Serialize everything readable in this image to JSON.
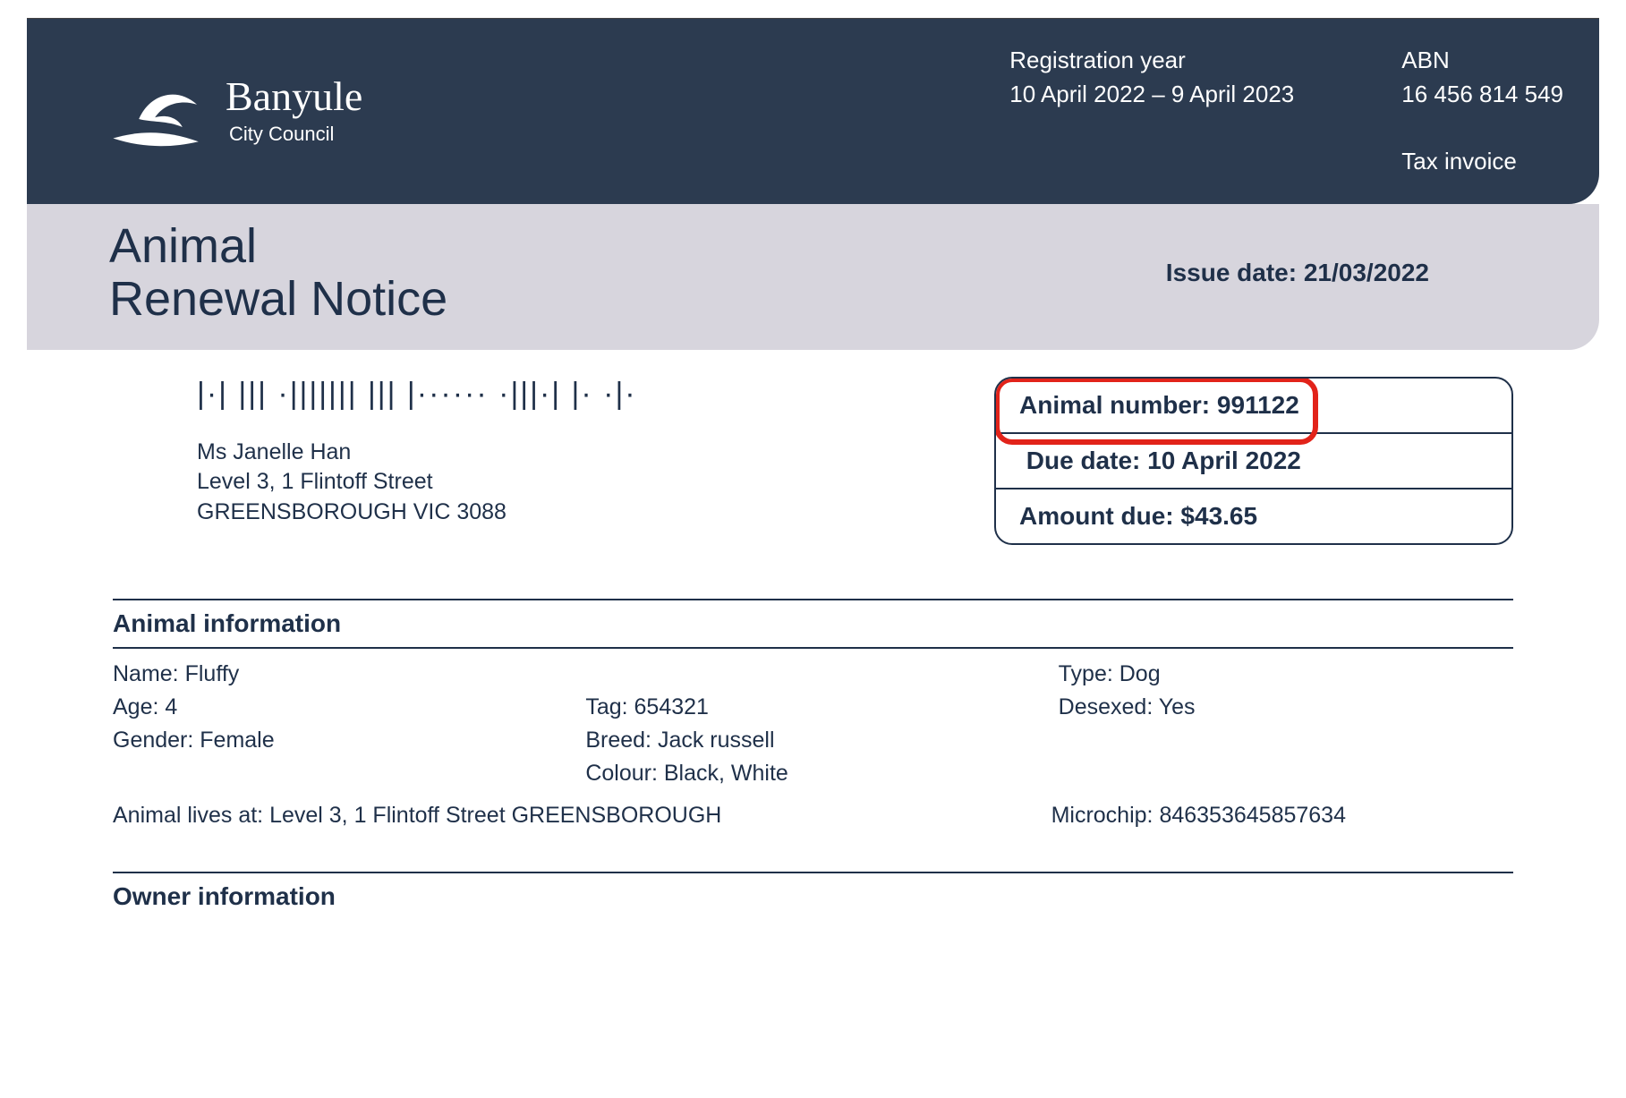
{
  "brand": {
    "name": "Banyule",
    "sub": "City Council"
  },
  "top": {
    "reg_label": "Registration year",
    "reg_value": "10 April 2022 – 9 April 2023",
    "abn_label": "ABN",
    "abn_value": "16 456 814 549",
    "tax_invoice": "Tax invoice"
  },
  "title_line1": "Animal",
  "title_line2": "Renewal Notice",
  "issue_date_label": "Issue date: ",
  "issue_date": "21/03/2022",
  "recipient": {
    "name": "Ms Janelle Han",
    "addr1": "Level 3, 1 Flintoff Street",
    "addr2": "GREENSBOROUGH  VIC  3088"
  },
  "keybox": {
    "animal_number_label": "Animal number: ",
    "animal_number": "991122",
    "due_date_label": "Due date: ",
    "due_date": "10 April 2022",
    "amount_due_label": "Amount due: ",
    "amount_due": "$43.65"
  },
  "sections": {
    "animal_info": "Animal information",
    "owner_info": "Owner information"
  },
  "animal": {
    "name_label": "Name: ",
    "name": "Fluffy",
    "age_label": "Age: ",
    "age": "4",
    "gender_label": "Gender: ",
    "gender": "Female",
    "tag_label": "Tag: ",
    "tag": "654321",
    "breed_label": "Breed: ",
    "breed": "Jack russell",
    "colour_label": "Colour: ",
    "colour": "Black, White",
    "type_label": "Type: ",
    "type": "Dog",
    "desexed_label": "Desexed: ",
    "desexed": "Yes",
    "lives_label": "Animal lives at: ",
    "lives_at": "Level 3, 1 Flintoff Street GREENSBOROUGH",
    "microchip_label": "Microchip: ",
    "microchip": "846353645857634"
  }
}
